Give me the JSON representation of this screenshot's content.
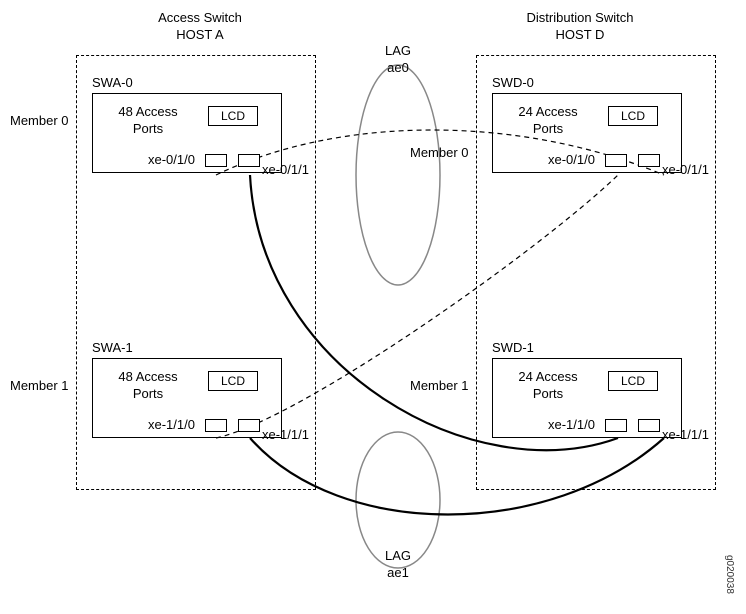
{
  "title_left_line1": "Access Switch",
  "title_left_line2": "HOST A",
  "title_right_line1": "Distribution Switch",
  "title_right_line2": "HOST D",
  "lag0_line1": "LAG",
  "lag0_line2": "ae0",
  "lag1_line1": "LAG",
  "lag1_line2": "ae1",
  "left_member0": "Member 0",
  "left_member1": "Member 1",
  "right_member0": "Member 0",
  "right_member1": "Member 1",
  "swa0": {
    "name": "SWA-0",
    "ports_line1": "48 Access",
    "ports_line2": "Ports",
    "lcd": "LCD",
    "port0": "xe-0/1/0",
    "port1": "xe-0/1/1"
  },
  "swa1": {
    "name": "SWA-1",
    "ports_line1": "48 Access",
    "ports_line2": "Ports",
    "lcd": "LCD",
    "port0": "xe-1/1/0",
    "port1": "xe-1/1/1"
  },
  "swd0": {
    "name": "SWD-0",
    "ports_line1": "24 Access",
    "ports_line2": "Ports",
    "lcd": "LCD",
    "port0": "xe-0/1/0",
    "port1": "xe-0/1/1"
  },
  "swd1": {
    "name": "SWD-1",
    "ports_line1": "24 Access",
    "ports_line2": "Ports",
    "lcd": "LCD",
    "port0": "xe-1/1/0",
    "port1": "xe-1/1/1"
  },
  "figure_id": "g020038"
}
